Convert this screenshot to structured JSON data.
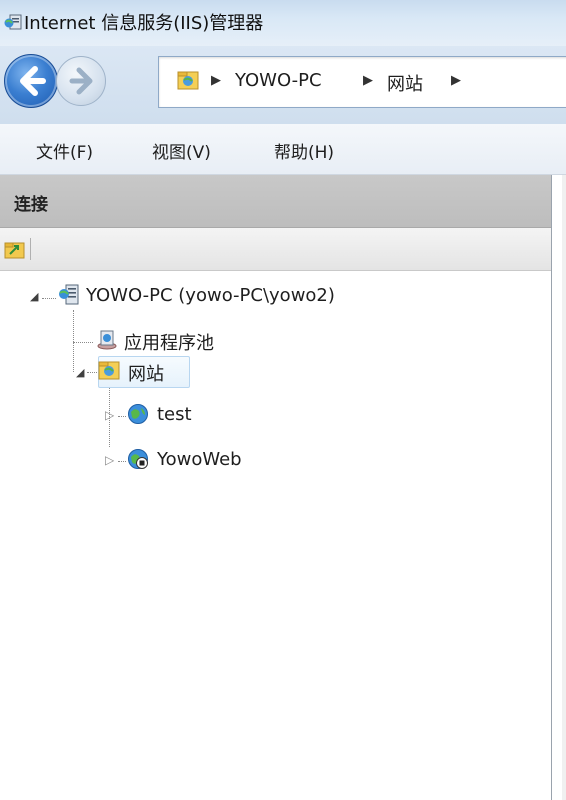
{
  "window": {
    "title": "Internet 信息服务(IIS)管理器",
    "app_icon": "iis-manager-icon"
  },
  "navigation": {
    "back_icon": "back-arrow-icon",
    "forward_icon": "forward-arrow-icon",
    "breadcrumb": [
      "YOWO-PC",
      "网站"
    ],
    "separator": "▶"
  },
  "menubar": {
    "items": [
      "文件(F)",
      "视图(V)",
      "帮助(H)"
    ]
  },
  "connections": {
    "header": "连接",
    "toolbar_icon": "create-connection-icon",
    "tree": {
      "server": "YOWO-PC (yowo-PC\\yowo2)",
      "app_pools": "应用程序池",
      "sites": "网站",
      "site_items": [
        "test",
        "YowoWeb"
      ]
    }
  },
  "colors": {
    "accent": "#3b7fd1",
    "header_gray": "#c4c4c4",
    "selection": "#e6f2fc"
  }
}
